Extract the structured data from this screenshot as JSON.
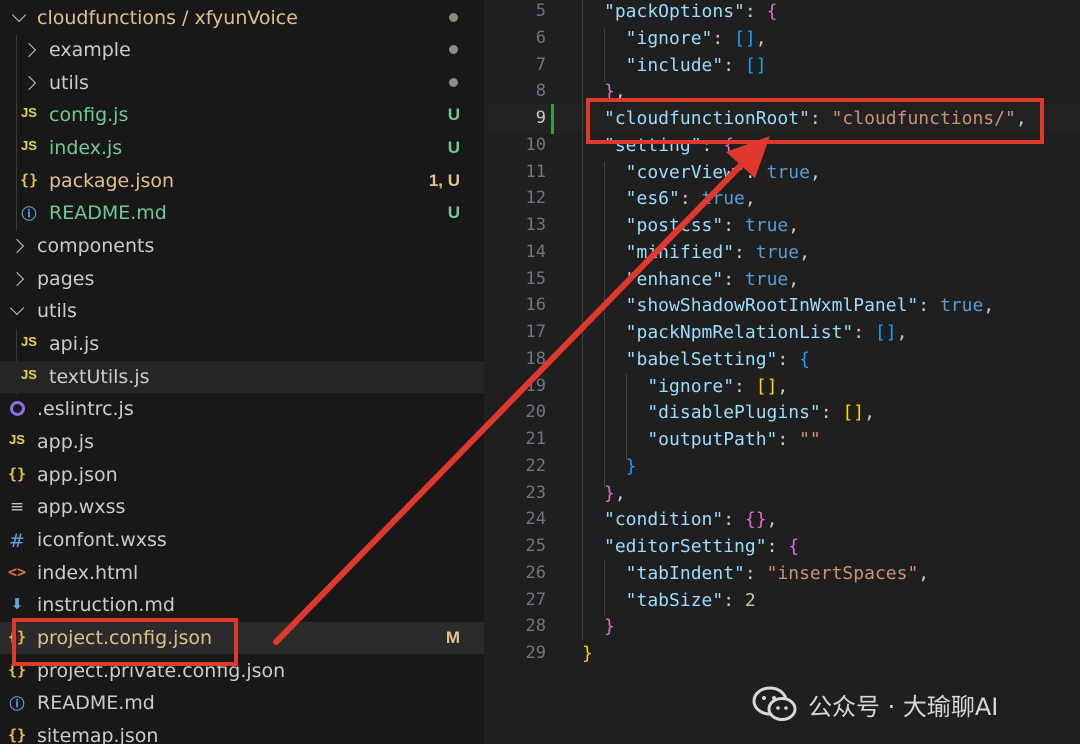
{
  "explorer": {
    "rows": [
      {
        "label": "cloudfunctions / xfyunVoice",
        "icon": "chevron-down",
        "status": "dot"
      },
      {
        "label": "example",
        "icon": "chevron-right",
        "status": "dot"
      },
      {
        "label": "utils",
        "icon": "chevron-right",
        "status": "dot"
      },
      {
        "label": "config.js",
        "icon": "JS",
        "badge": "U"
      },
      {
        "label": "index.js",
        "icon": "JS",
        "badge": "U"
      },
      {
        "label": "package.json",
        "icon": "{}",
        "badge": "1, U"
      },
      {
        "label": "README.md",
        "icon": "info",
        "badge": "U"
      },
      {
        "label": "components",
        "icon": "chevron-right"
      },
      {
        "label": "pages",
        "icon": "chevron-right"
      },
      {
        "label": "utils",
        "icon": "chevron-down"
      },
      {
        "label": "api.js",
        "icon": "JS"
      },
      {
        "label": "textUtils.js",
        "icon": "JS"
      },
      {
        "label": ".eslintrc.js",
        "icon": "eslint"
      },
      {
        "label": "app.js",
        "icon": "JS"
      },
      {
        "label": "app.json",
        "icon": "{}"
      },
      {
        "label": "app.wxss",
        "icon": "lines"
      },
      {
        "label": "iconfont.wxss",
        "icon": "#"
      },
      {
        "label": "index.html",
        "icon": "<>"
      },
      {
        "label": "instruction.md",
        "icon": "download"
      },
      {
        "label": "project.config.json",
        "icon": "{}",
        "badge": "M"
      },
      {
        "label": "project.private.config.json",
        "icon": "{}"
      },
      {
        "label": "README.md",
        "icon": "info"
      },
      {
        "label": "sitemap.json",
        "icon": "{}"
      }
    ],
    "icon_text": {
      "js": "JS",
      "json": "{}",
      "html": "<>",
      "hash": "#",
      "lines": "≡",
      "info": "ⓘ",
      "download": "⬇"
    }
  },
  "editor": {
    "line_numbers": [
      "5",
      "6",
      "7",
      "8",
      "9",
      "10",
      "11",
      "12",
      "13",
      "14",
      "15",
      "16",
      "17",
      "18",
      "19",
      "20",
      "21",
      "22",
      "23",
      "24",
      "25",
      "26",
      "27",
      "28",
      "29"
    ],
    "lines": [
      [
        {
          "t": "\"packOptions\"",
          "c": "k"
        },
        {
          "t": ": ",
          "c": "plain"
        },
        {
          "t": "{",
          "c": "p1"
        }
      ],
      [
        {
          "t": "  \"ignore\"",
          "c": "k"
        },
        {
          "t": ": ",
          "c": "plain"
        },
        {
          "t": "[]",
          "c": "p2"
        },
        {
          "t": ",",
          "c": "plain"
        }
      ],
      [
        {
          "t": "  \"include\"",
          "c": "k"
        },
        {
          "t": ": ",
          "c": "plain"
        },
        {
          "t": "[]",
          "c": "p2"
        }
      ],
      [
        {
          "t": "}",
          "c": "p1"
        },
        {
          "t": ",",
          "c": "plain"
        }
      ],
      [
        {
          "t": "\"cloudfunctionRoot\"",
          "c": "k"
        },
        {
          "t": ": ",
          "c": "plain"
        },
        {
          "t": "\"cloudfunctions/\"",
          "c": "s"
        },
        {
          "t": ",",
          "c": "plain"
        }
      ],
      [
        {
          "t": "\"setting\"",
          "c": "k"
        },
        {
          "t": ": ",
          "c": "plain"
        },
        {
          "t": "{",
          "c": "p1"
        }
      ],
      [
        {
          "t": "  \"coverView\"",
          "c": "k"
        },
        {
          "t": ": ",
          "c": "plain"
        },
        {
          "t": "true",
          "c": "kw"
        },
        {
          "t": ",",
          "c": "plain"
        }
      ],
      [
        {
          "t": "  \"es6\"",
          "c": "k"
        },
        {
          "t": ": ",
          "c": "plain"
        },
        {
          "t": "true",
          "c": "kw"
        },
        {
          "t": ",",
          "c": "plain"
        }
      ],
      [
        {
          "t": "  \"postcss\"",
          "c": "k"
        },
        {
          "t": ": ",
          "c": "plain"
        },
        {
          "t": "true",
          "c": "kw"
        },
        {
          "t": ",",
          "c": "plain"
        }
      ],
      [
        {
          "t": "  \"minified\"",
          "c": "k"
        },
        {
          "t": ": ",
          "c": "plain"
        },
        {
          "t": "true",
          "c": "kw"
        },
        {
          "t": ",",
          "c": "plain"
        }
      ],
      [
        {
          "t": "  \"enhance\"",
          "c": "k"
        },
        {
          "t": ": ",
          "c": "plain"
        },
        {
          "t": "true",
          "c": "kw"
        },
        {
          "t": ",",
          "c": "plain"
        }
      ],
      [
        {
          "t": "  \"showShadowRootInWxmlPanel\"",
          "c": "k"
        },
        {
          "t": ": ",
          "c": "plain"
        },
        {
          "t": "true",
          "c": "kw"
        },
        {
          "t": ",",
          "c": "plain"
        }
      ],
      [
        {
          "t": "  \"packNpmRelationList\"",
          "c": "k"
        },
        {
          "t": ": ",
          "c": "plain"
        },
        {
          "t": "[]",
          "c": "p2"
        },
        {
          "t": ",",
          "c": "plain"
        }
      ],
      [
        {
          "t": "  \"babelSetting\"",
          "c": "k"
        },
        {
          "t": ": ",
          "c": "plain"
        },
        {
          "t": "{",
          "c": "p2"
        }
      ],
      [
        {
          "t": "    \"ignore\"",
          "c": "k"
        },
        {
          "t": ": ",
          "c": "plain"
        },
        {
          "t": "[]",
          "c": "p3"
        },
        {
          "t": ",",
          "c": "plain"
        }
      ],
      [
        {
          "t": "    \"disablePlugins\"",
          "c": "k"
        },
        {
          "t": ": ",
          "c": "plain"
        },
        {
          "t": "[]",
          "c": "p3"
        },
        {
          "t": ",",
          "c": "plain"
        }
      ],
      [
        {
          "t": "    \"outputPath\"",
          "c": "k"
        },
        {
          "t": ": ",
          "c": "plain"
        },
        {
          "t": "\"\"",
          "c": "s"
        }
      ],
      [
        {
          "t": "  }",
          "c": "p2"
        }
      ],
      [
        {
          "t": "}",
          "c": "p1"
        },
        {
          "t": ",",
          "c": "plain"
        }
      ],
      [
        {
          "t": "\"condition\"",
          "c": "k"
        },
        {
          "t": ": ",
          "c": "plain"
        },
        {
          "t": "{}",
          "c": "p1"
        },
        {
          "t": ",",
          "c": "plain"
        }
      ],
      [
        {
          "t": "\"editorSetting\"",
          "c": "k"
        },
        {
          "t": ": ",
          "c": "plain"
        },
        {
          "t": "{",
          "c": "p1"
        }
      ],
      [
        {
          "t": "  \"tabIndent\"",
          "c": "k"
        },
        {
          "t": ": ",
          "c": "plain"
        },
        {
          "t": "\"insertSpaces\"",
          "c": "s"
        },
        {
          "t": ",",
          "c": "plain"
        }
      ],
      [
        {
          "t": "  \"tabSize\"",
          "c": "k"
        },
        {
          "t": ": ",
          "c": "plain"
        },
        {
          "t": "2",
          "c": "n"
        }
      ],
      [
        {
          "t": "}",
          "c": "p1"
        }
      ],
      [
        {
          "t": "}",
          "c": "p3"
        }
      ]
    ]
  },
  "watermark": {
    "text": "公众号 · 大瑜聊AI"
  },
  "colors": {
    "annotation": "#e0382c",
    "background": "#1f1f1f",
    "sidebar": "#181818"
  }
}
